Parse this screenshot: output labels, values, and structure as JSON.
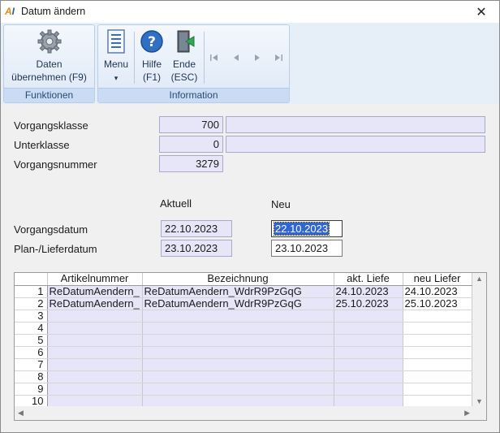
{
  "window": {
    "title": "Datum ändern",
    "close_glyph": "✕"
  },
  "ribbon": {
    "groups": [
      {
        "caption": "Funktionen"
      },
      {
        "caption": "Information"
      }
    ],
    "buttons": {
      "daten": {
        "line1": "Daten",
        "line2": "übernehmen (F9)",
        "icon": "gear-icon"
      },
      "menu": {
        "line1": "Menu",
        "line2": "▾",
        "icon": "menu-list-icon"
      },
      "hilfe": {
        "line1": "Hilfe",
        "line2": "(F1)",
        "icon": "help-icon"
      },
      "ende": {
        "line1": "Ende",
        "line2": "(ESC)",
        "icon": "exit-door-icon"
      }
    },
    "nav": [
      "first-record-icon",
      "previous-record-icon",
      "next-record-icon",
      "last-record-icon"
    ]
  },
  "form": {
    "vorgangsklasse": {
      "label": "Vorgangsklasse",
      "value": "700",
      "text": ""
    },
    "unterklasse": {
      "label": "Unterklasse",
      "value": "0",
      "text": ""
    },
    "vorgangsnummer": {
      "label": "Vorgangsnummer",
      "value": "3279"
    },
    "col_aktuell": "Aktuell",
    "col_neu": "Neu",
    "vorgangsdatum": {
      "label": "Vorgangsdatum",
      "aktuell": "22.10.2023",
      "neu": "22.10.2023"
    },
    "lieferdatum": {
      "label": "Plan-/Lieferdatum",
      "aktuell": "23.10.2023",
      "neu": "23.10.2023"
    }
  },
  "grid": {
    "headers": [
      "",
      "Artikelnummer",
      "Bezeichnung",
      "akt. Liefe",
      "neu Liefer"
    ],
    "rows": [
      {
        "n": "1",
        "artikel": "ReDatumAendern_",
        "bez": "ReDatumAendern_WdrR9PzGqG",
        "akt": "24.10.2023",
        "neu": "24.10.2023"
      },
      {
        "n": "2",
        "artikel": "ReDatumAendern_",
        "bez": "ReDatumAendern_WdrR9PzGqG",
        "akt": "25.10.2023",
        "neu": "25.10.2023"
      },
      {
        "n": "3",
        "artikel": "",
        "bez": "",
        "akt": "",
        "neu": ""
      },
      {
        "n": "4",
        "artikel": "",
        "bez": "",
        "akt": "",
        "neu": ""
      },
      {
        "n": "5",
        "artikel": "",
        "bez": "",
        "akt": "",
        "neu": ""
      },
      {
        "n": "6",
        "artikel": "",
        "bez": "",
        "akt": "",
        "neu": ""
      },
      {
        "n": "7",
        "artikel": "",
        "bez": "",
        "akt": "",
        "neu": ""
      },
      {
        "n": "8",
        "artikel": "",
        "bez": "",
        "akt": "",
        "neu": ""
      },
      {
        "n": "9",
        "artikel": "",
        "bez": "",
        "akt": "",
        "neu": ""
      },
      {
        "n": "10",
        "artikel": "",
        "bez": "",
        "akt": "",
        "neu": ""
      }
    ]
  }
}
